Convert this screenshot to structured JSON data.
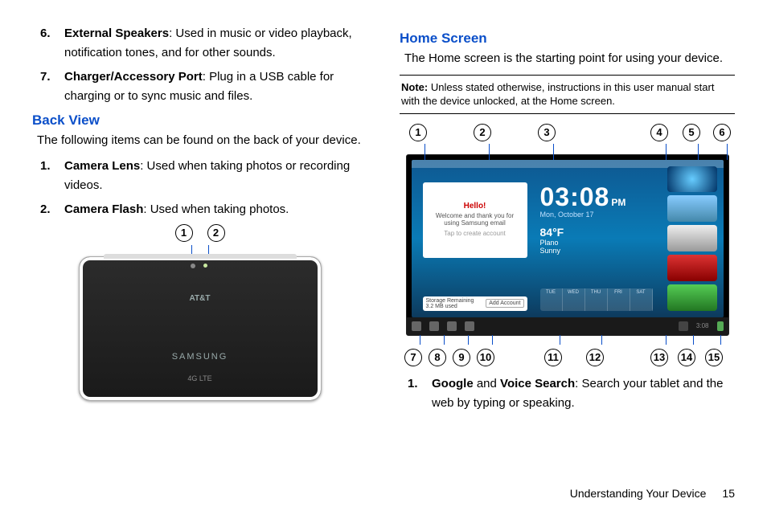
{
  "left": {
    "items_cont": [
      {
        "n": "6.",
        "term": "External Speakers",
        "desc": ": Used in music or video playback, notification tones, and for other sounds."
      },
      {
        "n": "7.",
        "term": "Charger/Accessory Port",
        "desc": ": Plug in a USB cable for charging or to sync music and files."
      }
    ],
    "back_view_head": "Back View",
    "back_view_intro": "The following items can be found on the back of your device.",
    "back_items": [
      {
        "n": "1.",
        "term": "Camera Lens",
        "desc": ": Used when taking photos or recording videos."
      },
      {
        "n": "2.",
        "term": "Camera Flash",
        "desc": ": Used when taking photos."
      }
    ],
    "diagram": {
      "callouts": [
        "1",
        "2"
      ],
      "att": "AT&T",
      "samsung": "SAMSUNG",
      "lte": "4G LTE"
    }
  },
  "right": {
    "home_head": "Home Screen",
    "home_intro": "The Home screen is the starting point for using your device.",
    "note_label": "Note:",
    "note_text": " Unless stated otherwise, instructions in this user manual start with the device unlocked, at the Home screen.",
    "top_callouts": [
      "1",
      "2",
      "3",
      "4",
      "5",
      "6"
    ],
    "bot_callouts": [
      "7",
      "8",
      "9",
      "10",
      "11",
      "12",
      "13",
      "14",
      "15"
    ],
    "screen": {
      "clock": "03:08",
      "ampm": "PM",
      "date": "Mon, October 17",
      "email_hello": "Hello!",
      "email_sub": "Welcome and thank you for using Samsung email",
      "email_tap": "Tap to create account",
      "weather_temp": "84°F",
      "weather_loc": "Plano",
      "weather_cond": "Sunny",
      "cal": [
        "TUE",
        "WED",
        "THU",
        "FRI",
        "SAT"
      ],
      "storage_text": "Storage Remaining",
      "storage_used": "3.2 MB used",
      "storage_btn": "Add Account",
      "nav_time": "3:08"
    },
    "below_items": [
      {
        "n": "1.",
        "term": "Google",
        "mid": " and ",
        "term2": "Voice Search",
        "desc": ": Search your tablet and the web by typing or speaking."
      }
    ]
  },
  "footer": {
    "section": "Understanding Your Device",
    "page": "15"
  }
}
